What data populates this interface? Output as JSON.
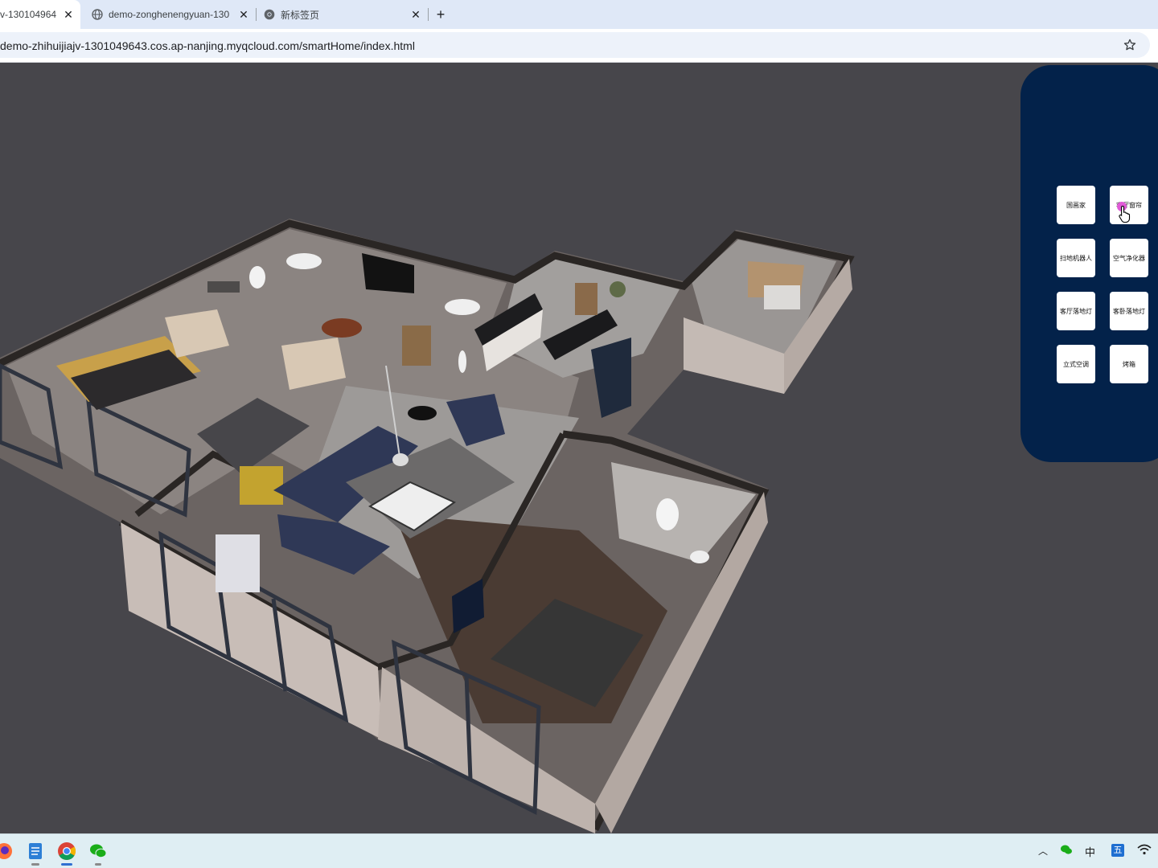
{
  "browser": {
    "tabs": [
      {
        "title": "v-130104964",
        "close": "✕",
        "active": true
      },
      {
        "title": "demo-zonghenengyuan-130",
        "close": "✕",
        "active": false
      },
      {
        "title": "新标签页",
        "close": "✕",
        "active": false
      }
    ],
    "new_tab": "+",
    "url": "demo-zhihuijiajv-1301049643.cos.ap-nanjing.myqcloud.com/smartHome/index.html"
  },
  "panel": {
    "devices": [
      {
        "label": "国画家"
      },
      {
        "label": "客厅窗帘"
      },
      {
        "label": "扫地机器人"
      },
      {
        "label": "空气净化器"
      },
      {
        "label": "客厅落地灯"
      },
      {
        "label": "客卧落地灯"
      },
      {
        "label": "立式空调"
      },
      {
        "label": "烤箱"
      }
    ]
  },
  "taskbar": {
    "apps": [
      "firefox-icon",
      "notepad-icon",
      "chrome-icon",
      "wechat-icon"
    ],
    "tray": {
      "lang1": "中",
      "lang2": "五"
    }
  },
  "colors": {
    "scene_background": "#47464b",
    "panel_background": "#03224a",
    "tabstrip": "#dfe8f7",
    "omnibox": "#edf2fa"
  }
}
